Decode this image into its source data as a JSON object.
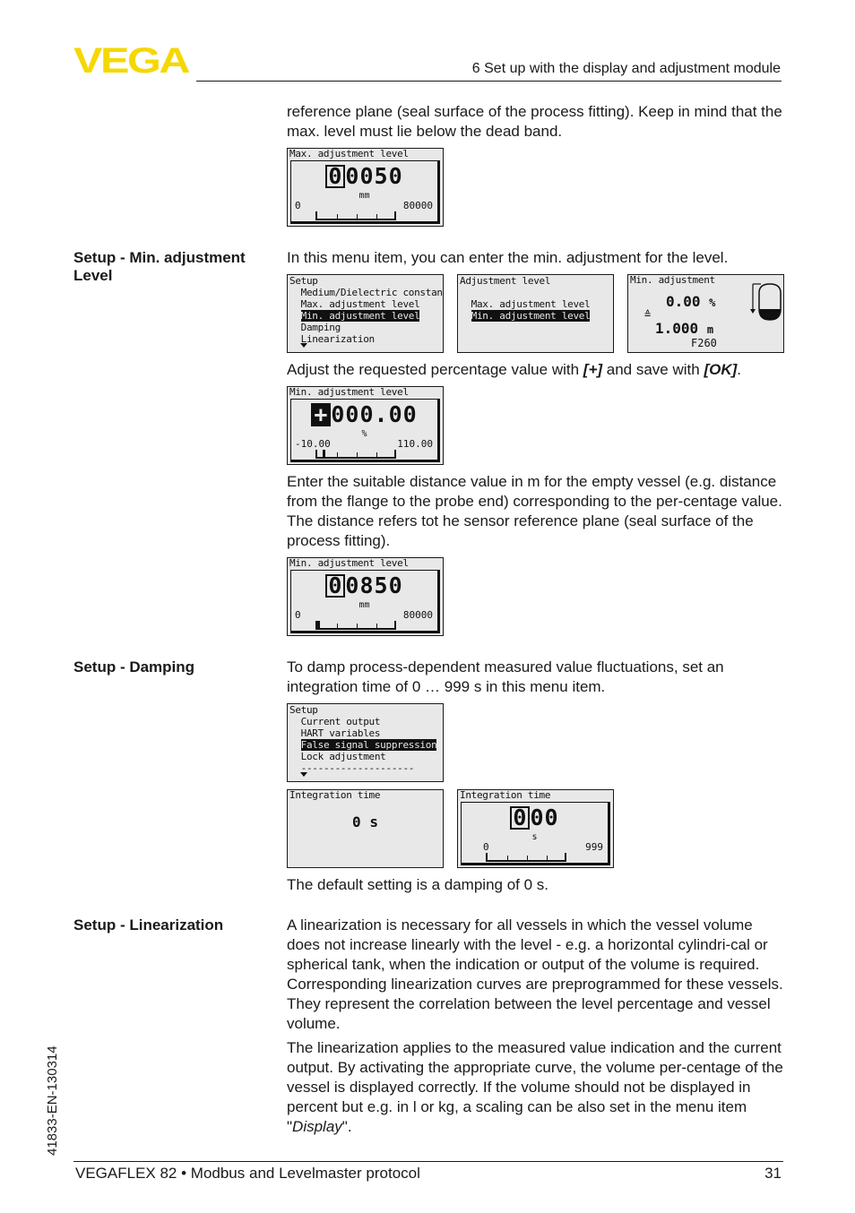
{
  "header": {
    "logo_text": "VEGA",
    "brand_color": "#f5d800",
    "section_title": "6 Set up with the display and adjustment module"
  },
  "intro": {
    "text": "reference plane (seal surface of the process fitting). Keep in mind that the max. level must lie below the dead band."
  },
  "screens": {
    "max_adjust": {
      "title": "Max. adjustment level",
      "cursor_digit": "0",
      "rest": "0050",
      "unit": "mm",
      "min": "0",
      "max": "80000"
    },
    "setup_menu1": {
      "title": "Setup",
      "items": [
        "Medium/Dielectric constant",
        "Max. adjustment level",
        "Min. adjustment level",
        "Damping",
        "Linearization"
      ],
      "selected_index": 2
    },
    "adjust_level": {
      "title": "Adjustment level",
      "items": [
        "Max. adjustment level",
        "Min. adjustment level"
      ],
      "selected_index": 1
    },
    "min_adjust_overview": {
      "title": "Min. adjustment",
      "percent": "0.00",
      "percent_unit": "%",
      "equiv": "≙",
      "distance": "1.000",
      "distance_unit": "m",
      "code": "F260"
    },
    "min_adjust_percent": {
      "title": "Min. adjustment level",
      "cursor_digit": "+",
      "rest": "000.00",
      "unit": "%",
      "min": "-10.00",
      "max": "110.00"
    },
    "min_adjust_distance": {
      "title": "Min. adjustment level",
      "cursor_digit": "0",
      "rest": "0850",
      "unit": "mm",
      "min": "0",
      "max": "80000"
    },
    "setup_menu2": {
      "title": "Setup",
      "items": [
        "Current output",
        "HART variables",
        "False signal suppression",
        "Lock adjustment",
        "--------------------"
      ],
      "selected_index": 2
    },
    "integration_view": {
      "title": "Integration time",
      "value": "0 s"
    },
    "integration_edit": {
      "title": "Integration time",
      "cursor_digit": "0",
      "rest": "00",
      "unit": "s",
      "min": "0",
      "max": "999"
    }
  },
  "sections": {
    "min_adjust": {
      "heading": "Setup - Min. adjustment Level",
      "p1": "In this menu item, you can enter the min. adjustment for the level.",
      "p2_a": "Adjust the requested percentage value with ",
      "p2_key1": "[+]",
      "p2_b": " and save with ",
      "p2_key2": "[OK]",
      "p2_c": ".",
      "p3": "Enter the suitable distance value in m for the empty vessel (e.g. distance from the flange to the probe end) corresponding to the per-centage value. The distance refers tot he sensor reference plane (seal surface of the process fitting)."
    },
    "damping": {
      "heading": "Setup - Damping",
      "p1": "To damp process-dependent measured value fluctuations, set an integration time of 0 … 999 s in this menu item.",
      "p2": "The default setting is a damping of 0 s."
    },
    "linearization": {
      "heading": "Setup - Linearization",
      "p1": "A linearization is necessary for all vessels in which the vessel volume does not increase linearly with the level - e.g. a horizontal cylindri-cal or spherical tank, when the indication or output of the volume is required. Corresponding linearization curves are preprogrammed for these vessels. They represent the correlation between the level percentage and vessel volume.",
      "p2_a": "The linearization applies to the measured value indication and the current output. By activating the appropriate curve, the volume per-centage of the vessel is displayed correctly. If the volume should not be displayed in percent but e.g. in l or kg, a scaling can be also set in the menu item \"",
      "p2_link": "Display",
      "p2_b": "\"."
    }
  },
  "footer": {
    "product": "VEGAFLEX 82 • Modbus and Levelmaster protocol",
    "page": "31",
    "doc_id": "41833-EN-130314"
  }
}
